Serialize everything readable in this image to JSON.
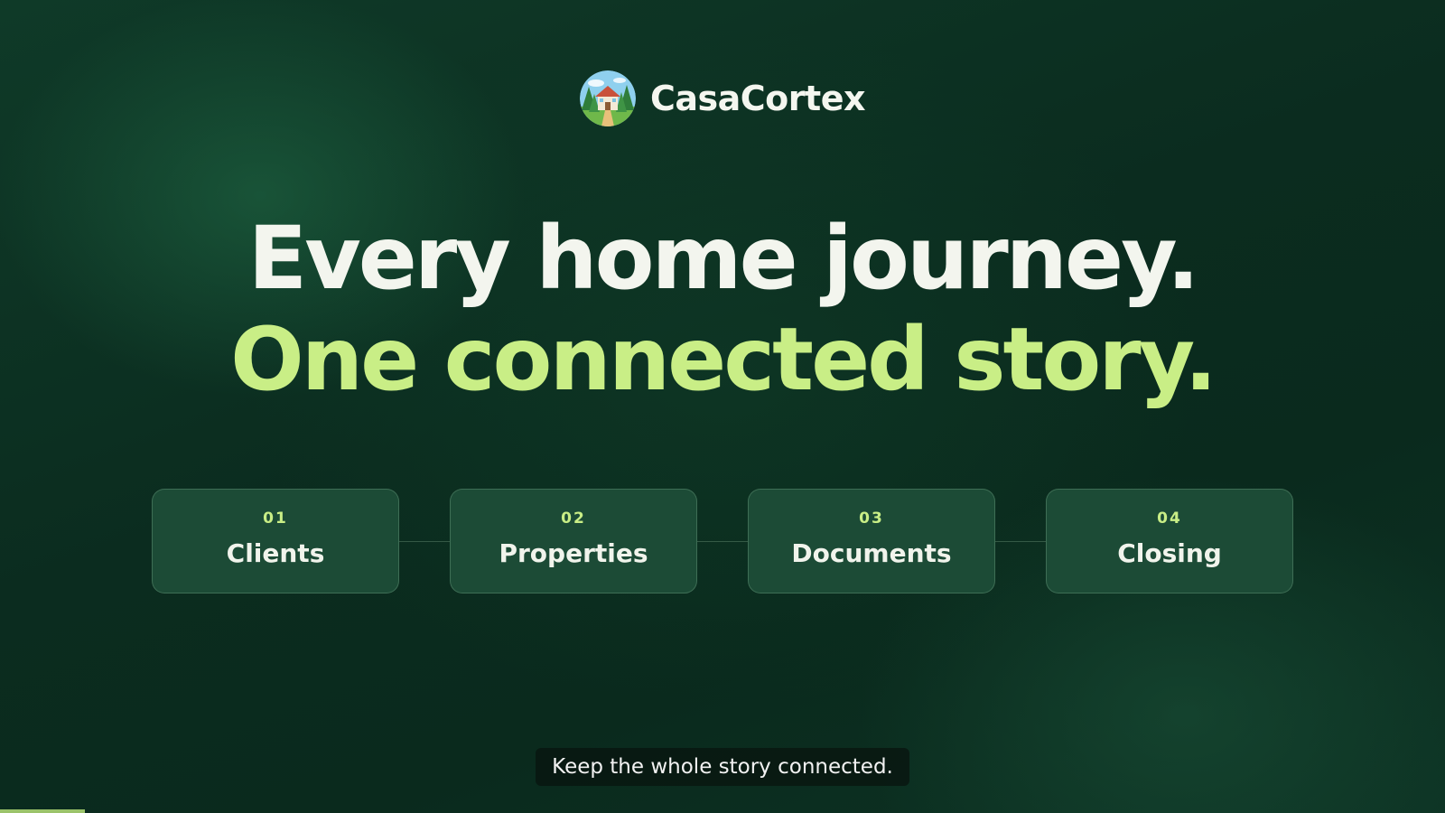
{
  "brand": {
    "name": "CasaCortex",
    "logo_icon": "house-in-forest-icon"
  },
  "headline": {
    "line1": "Every home journey.",
    "line2": "One connected story."
  },
  "steps": [
    {
      "number": "01",
      "label": "Clients"
    },
    {
      "number": "02",
      "label": "Properties"
    },
    {
      "number": "03",
      "label": "Documents"
    },
    {
      "number": "04",
      "label": "Closing"
    }
  ],
  "caption": "Keep the whole story connected.",
  "progress": 0.059,
  "colors": {
    "background": "#0b2c1f",
    "accent": "#c9ee86",
    "card": "#1c4b36",
    "text": "#f3f5ee"
  }
}
